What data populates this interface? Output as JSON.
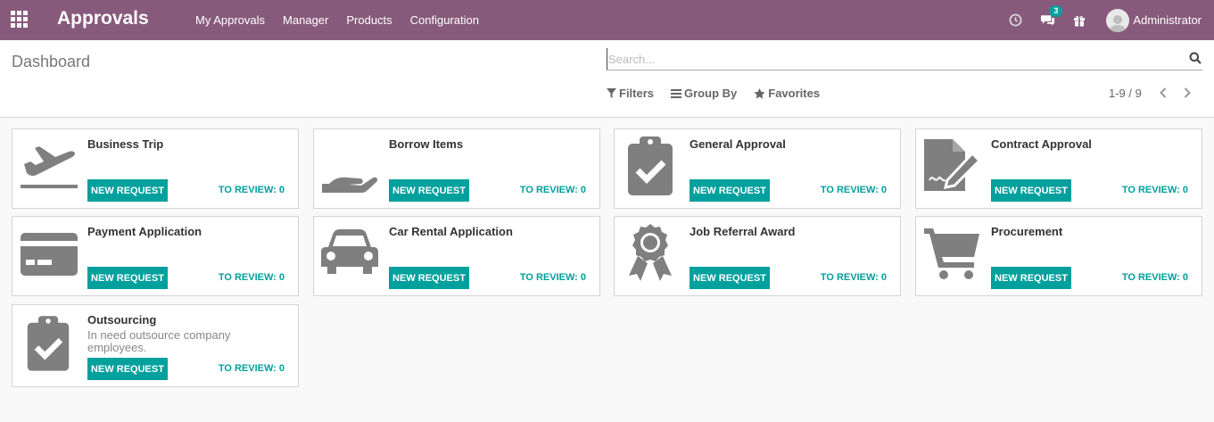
{
  "navbar": {
    "app_title": "Approvals",
    "menu": [
      "My Approvals",
      "Manager",
      "Products",
      "Configuration"
    ],
    "messages_count": "3",
    "user_name": "Administrator"
  },
  "control_panel": {
    "breadcrumb": "Dashboard",
    "search_placeholder": "Search...",
    "filters_label": "Filters",
    "group_by_label": "Group By",
    "favorites_label": "Favorites",
    "pager": "1-9 / 9"
  },
  "accent_color": "#00a09d",
  "navbar_color": "#875a7b",
  "cards": [
    {
      "title": "Business Trip",
      "icon": "plane-departure-icon",
      "description": "",
      "new_label": "NEW REQUEST",
      "review_label": "TO REVIEW: 0"
    },
    {
      "title": "Borrow Items",
      "icon": "hand-holding-icon",
      "description": "",
      "new_label": "NEW REQUEST",
      "review_label": "TO REVIEW: 0"
    },
    {
      "title": "General Approval",
      "icon": "clipboard-check-icon",
      "description": "",
      "new_label": "NEW REQUEST",
      "review_label": "TO REVIEW: 0"
    },
    {
      "title": "Contract Approval",
      "icon": "file-signature-icon",
      "description": "",
      "new_label": "NEW REQUEST",
      "review_label": "TO REVIEW: 0"
    },
    {
      "title": "Payment Application",
      "icon": "credit-card-icon",
      "description": "",
      "new_label": "NEW REQUEST",
      "review_label": "TO REVIEW: 0"
    },
    {
      "title": "Car Rental Application",
      "icon": "car-icon",
      "description": "",
      "new_label": "NEW REQUEST",
      "review_label": "TO REVIEW: 0"
    },
    {
      "title": "Job Referral Award",
      "icon": "award-icon",
      "description": "",
      "new_label": "NEW REQUEST",
      "review_label": "TO REVIEW: 0"
    },
    {
      "title": "Procurement",
      "icon": "shopping-cart-icon",
      "description": "",
      "new_label": "NEW REQUEST",
      "review_label": "TO REVIEW: 0"
    },
    {
      "title": "Outsourcing",
      "icon": "clipboard-check-icon",
      "description": "In need outsource company employees.",
      "new_label": "NEW REQUEST",
      "review_label": "TO REVIEW: 0"
    }
  ]
}
